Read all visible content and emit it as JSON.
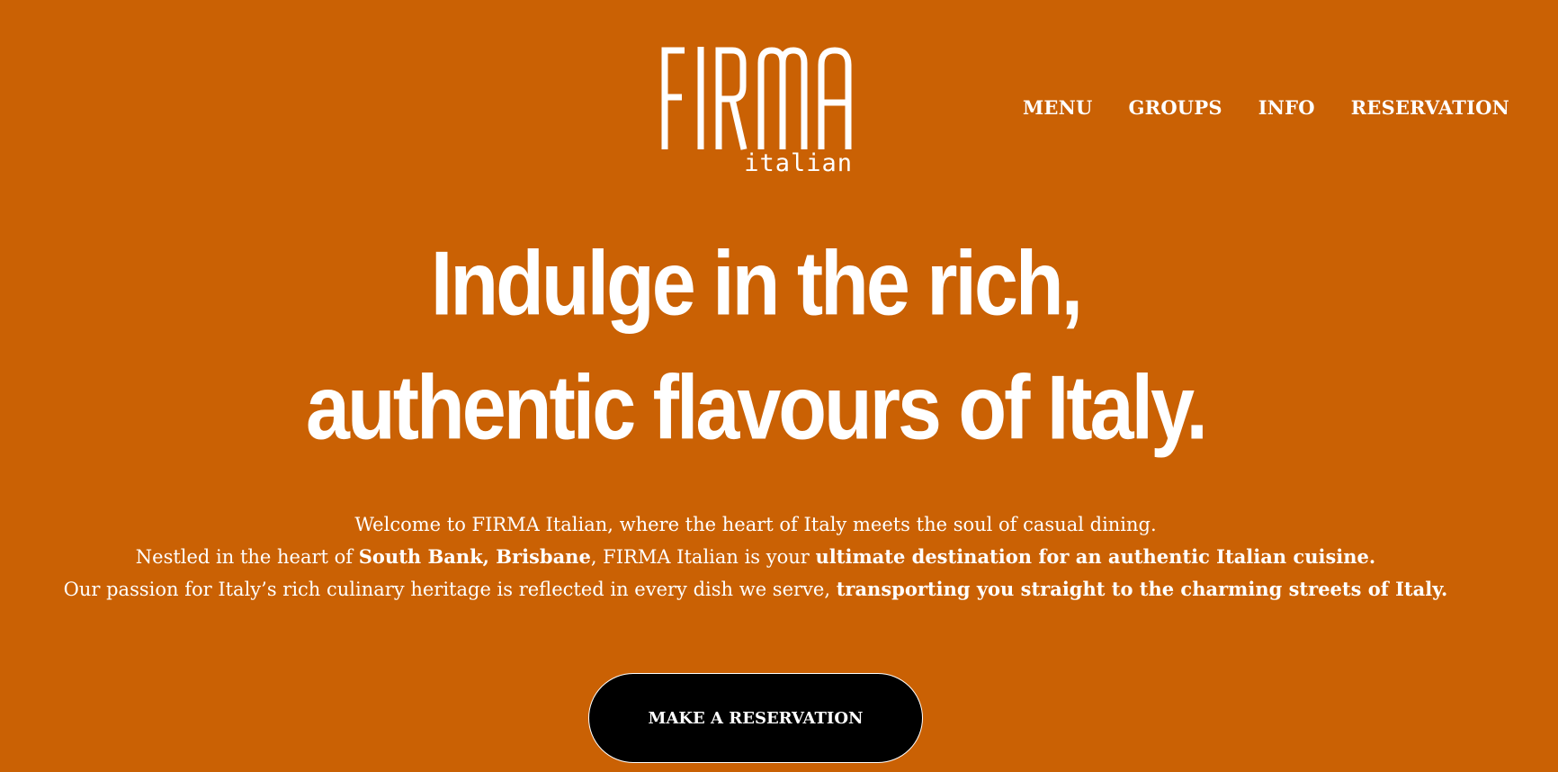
{
  "brand": {
    "name": "FIRMA",
    "subtitle": "italian"
  },
  "nav": {
    "items": [
      {
        "label": "MENU"
      },
      {
        "label": "GROUPS"
      },
      {
        "label": "INFO"
      },
      {
        "label": "RESERVATION"
      }
    ]
  },
  "hero": {
    "headline_line1": "Indulge in the rich,",
    "headline_line2": "authentic flavours of Italy."
  },
  "intro": {
    "line1": "Welcome to FIRMA Italian, where the heart of Italy meets the soul of casual dining.",
    "line2_part1": "Nestled in the heart of ",
    "line2_bold1": "South Bank, Brisbane",
    "line2_part2": ", FIRMA Italian is your ",
    "line2_bold2": "ultimate destination for an authentic Italian cuisine.",
    "line3_part1": "Our passion for Italy’s rich culinary heritage is reflected in every dish we serve, ",
    "line3_bold1": "transporting you straight to the charming streets of Italy."
  },
  "cta": {
    "label": "MAKE A RESERVATION"
  },
  "colors": {
    "background": "#CA6104",
    "text": "#FFFFFF",
    "button": "#000000"
  }
}
